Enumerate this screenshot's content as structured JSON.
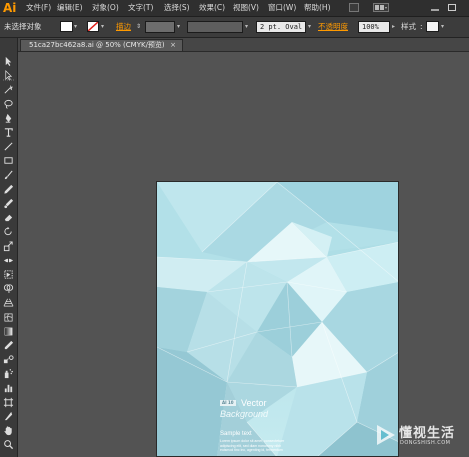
{
  "app": {
    "logo": "Ai"
  },
  "menubar": {
    "items": [
      {
        "label": "文件(F)"
      },
      {
        "label": "编辑(E)"
      },
      {
        "label": "对象(O)"
      },
      {
        "label": "文字(T)"
      },
      {
        "label": "选择(S)"
      },
      {
        "label": "效果(C)"
      },
      {
        "label": "视图(V)"
      },
      {
        "label": "窗口(W)"
      },
      {
        "label": "帮助(H)"
      }
    ]
  },
  "control_bar": {
    "selection_status": "未选择对象",
    "stroke_label": "描边",
    "brush_value": "2 pt. Oval",
    "opacity_label": "不透明度",
    "opacity_value": "100%",
    "style_label": "样式"
  },
  "document_tab": {
    "title": "51ca27bc462a8.ai @ 50% (CMYK/预览)",
    "close": "×"
  },
  "document": {
    "badge": "AI 10",
    "heading_1": "Vector",
    "heading_2": "Background",
    "sample_title": "Sample text",
    "sample_lines": [
      "Lorem ipsum dolor sit amet, consectetuer",
      "adipiscing elit, sed diam nonummy nibh",
      "euismod tinc inc, agenting id, fermentum"
    ]
  },
  "watermark": {
    "brand": "懂视生活",
    "url": "DONGSHISH.COM"
  },
  "colors": {
    "accent": "#ff9a00",
    "menubar_bg": "#2f2f2f",
    "workspace_bg": "#535353",
    "artboard_base": "#b9e3eb"
  },
  "tools": [
    {
      "icon": "selection-tool-icon"
    },
    {
      "icon": "direct-selection-tool-icon"
    },
    {
      "icon": "magic-wand-tool-icon"
    },
    {
      "icon": "lasso-tool-icon"
    },
    {
      "icon": "pen-tool-icon"
    },
    {
      "icon": "type-tool-icon"
    },
    {
      "icon": "line-tool-icon"
    },
    {
      "icon": "rectangle-tool-icon"
    },
    {
      "icon": "paintbrush-tool-icon"
    },
    {
      "icon": "pencil-tool-icon"
    },
    {
      "icon": "blob-brush-tool-icon"
    },
    {
      "icon": "eraser-tool-icon"
    },
    {
      "icon": "rotate-tool-icon"
    },
    {
      "icon": "scale-tool-icon"
    },
    {
      "icon": "width-tool-icon"
    },
    {
      "icon": "free-transform-tool-icon"
    },
    {
      "icon": "shape-builder-tool-icon"
    },
    {
      "icon": "perspective-grid-tool-icon"
    },
    {
      "icon": "mesh-tool-icon"
    },
    {
      "icon": "gradient-tool-icon"
    },
    {
      "icon": "eyedropper-tool-icon"
    },
    {
      "icon": "blend-tool-icon"
    },
    {
      "icon": "symbol-sprayer-tool-icon"
    },
    {
      "icon": "column-graph-tool-icon"
    },
    {
      "icon": "artboard-tool-icon"
    },
    {
      "icon": "slice-tool-icon"
    },
    {
      "icon": "hand-tool-icon"
    },
    {
      "icon": "zoom-tool-icon"
    }
  ]
}
